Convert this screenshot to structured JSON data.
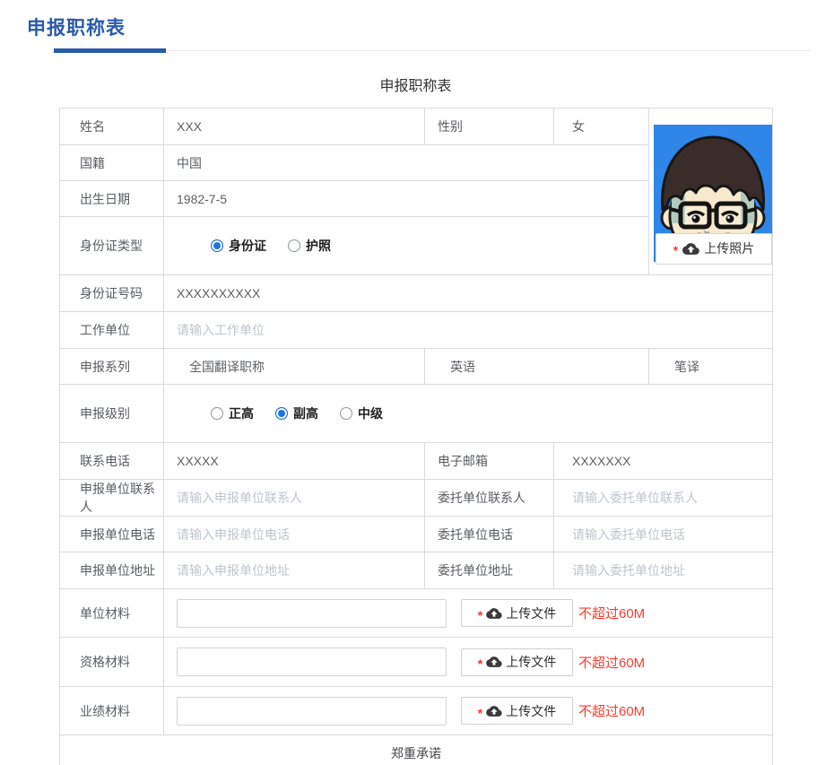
{
  "page": {
    "header_title": "申报职称表",
    "form_title": "申报职称表"
  },
  "colors": {
    "accent_blue": "#2a5aaa",
    "photo_background_blue": "#2e86e8",
    "radio_checked_blue": "#1a73e8",
    "required_red": "#f5332b",
    "hint_red": "#fb3a2f",
    "table_border": "#dadada"
  },
  "fields": {
    "name": {
      "label": "姓名",
      "value": "XXX"
    },
    "gender": {
      "label": "性别",
      "value": "女"
    },
    "nationality": {
      "label": "国籍",
      "value": "中国"
    },
    "birth_date": {
      "label": "出生日期",
      "value": "1982-7-5"
    },
    "id_type": {
      "label": "身份证类型",
      "options": [
        {
          "label": "身份证",
          "checked": true
        },
        {
          "label": "护照",
          "checked": false
        }
      ]
    },
    "id_number": {
      "label": "身份证号码",
      "value": "XXXXXXXXXX"
    },
    "work_unit": {
      "label": "工作单位",
      "value": "",
      "placeholder": "请输入工作单位"
    },
    "series": {
      "label": "申报系列",
      "values": [
        "全国翻译职称",
        "英语",
        "笔译"
      ]
    },
    "level": {
      "label": "申报级别",
      "options": [
        {
          "label": "正高",
          "checked": false
        },
        {
          "label": "副高",
          "checked": true
        },
        {
          "label": "中级",
          "checked": false
        }
      ]
    },
    "phone": {
      "label": "联系电话",
      "value": "XXXXX"
    },
    "email": {
      "label": "电子邮箱",
      "value": "XXXXXXX"
    },
    "declare_contact": {
      "label": "申报单位联系人",
      "value": "",
      "placeholder": "请输入申报单位联系人"
    },
    "entrust_contact": {
      "label": "委托单位联系人",
      "value": "",
      "placeholder": "请输入委托单位联系人"
    },
    "declare_phone": {
      "label": "申报单位电话",
      "value": "",
      "placeholder": "请输入申报单位电话"
    },
    "entrust_phone": {
      "label": "委托单位电话",
      "value": "",
      "placeholder": "请输入委托单位电话"
    },
    "declare_address": {
      "label": "申报单位地址",
      "value": "",
      "placeholder": "请输入申报单位地址"
    },
    "entrust_address": {
      "label": "委托单位地址",
      "value": "",
      "placeholder": "请输入委托单位地址"
    },
    "unit_material": {
      "label": "单位材料",
      "value": ""
    },
    "qualification_material": {
      "label": "资格材料",
      "value": ""
    },
    "performance_material": {
      "label": "业绩材料",
      "value": ""
    }
  },
  "photo": {
    "required_mark": "*",
    "upload_label": "上传照片"
  },
  "upload": {
    "required_mark": "*",
    "button_label": "上传文件",
    "size_hint": "不超过60M"
  },
  "footer": {
    "promise": "郑重承诺"
  }
}
